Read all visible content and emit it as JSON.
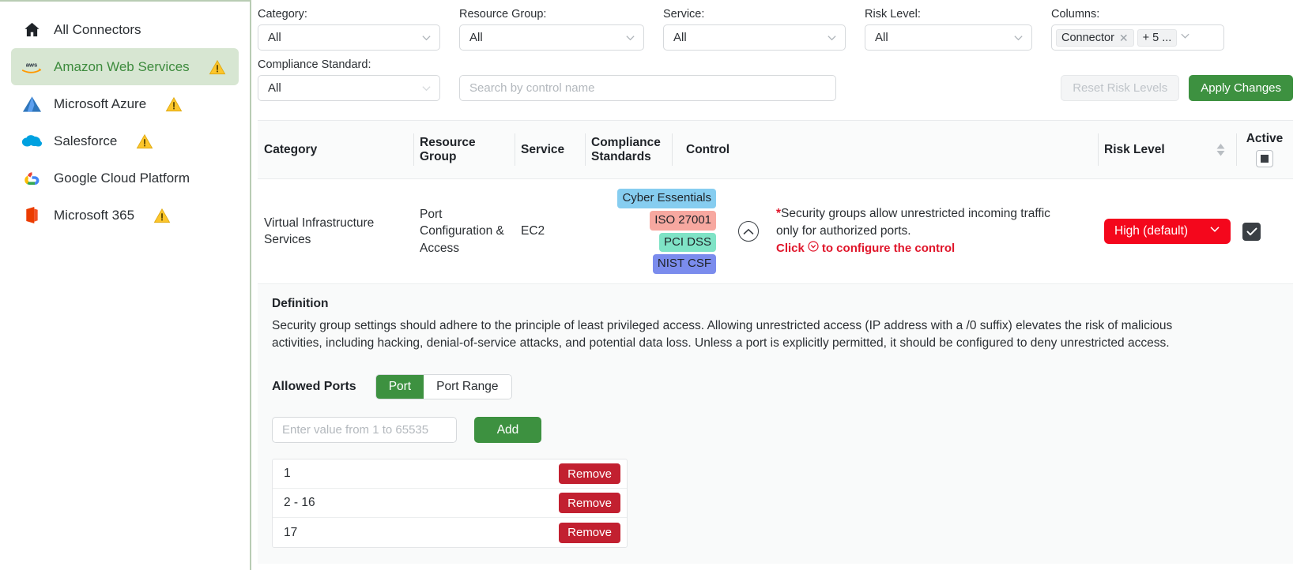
{
  "sidebar": {
    "items": [
      {
        "label": "All Connectors",
        "icon": "home-icon",
        "warning": false,
        "active": false
      },
      {
        "label": "Amazon Web Services",
        "icon": "aws-icon",
        "warning": true,
        "active": true
      },
      {
        "label": "Microsoft Azure",
        "icon": "azure-icon",
        "warning": true,
        "active": false
      },
      {
        "label": "Salesforce",
        "icon": "salesforce-icon",
        "warning": true,
        "active": false
      },
      {
        "label": "Google Cloud Platform",
        "icon": "gcp-icon",
        "warning": false,
        "active": false
      },
      {
        "label": "Microsoft 365",
        "icon": "microsoft365-icon",
        "warning": true,
        "active": false
      }
    ]
  },
  "filters": {
    "category": {
      "label": "Category:",
      "value": "All"
    },
    "resource_group": {
      "label": "Resource Group:",
      "value": "All"
    },
    "service": {
      "label": "Service:",
      "value": "All"
    },
    "risk_level": {
      "label": "Risk Level:",
      "value": "All"
    },
    "columns": {
      "label": "Columns:",
      "chip": "Connector",
      "more": "+ 5 ..."
    },
    "compliance_standard": {
      "label": "Compliance Standard:",
      "value": "All"
    },
    "search_placeholder": "Search by control name",
    "search_value": "",
    "reset_button": "Reset Risk Levels",
    "apply_button": "Apply Changes"
  },
  "table": {
    "headers": {
      "category": "Category",
      "resource_group": "Resource Group",
      "service": "Service",
      "compliance_standards": "Compliance Standards",
      "control": "Control",
      "risk_level": "Risk Level",
      "active": "Active"
    },
    "rows": [
      {
        "category": "Virtual Infrastructure Services",
        "resource_group": "Port Configuration & Access",
        "service": "EC2",
        "badges": [
          {
            "label": "Cyber Essentials",
            "color": "#86cdf0"
          },
          {
            "label": "ISO 27001",
            "color": "#f7a8a0"
          },
          {
            "label": "PCI DSS",
            "color": "#7fe3c6"
          },
          {
            "label": "NIST CSF",
            "color": "#7b8ced"
          }
        ],
        "control_text": "Security groups allow unrestricted incoming traffic only for authorized ports.",
        "control_required_marker": "*",
        "config_hint_prefix": "Click",
        "config_hint_suffix": "to configure the control",
        "risk_level": "High (default)",
        "active": true
      }
    ]
  },
  "detail": {
    "definition_title": "Definition",
    "definition_text": "Security group settings should adhere to the principle of least privileged access. Allowing unrestricted access (IP address with a /0 suffix) elevates the risk of malicious activities, including hacking, denial-of-service attacks, and potential data loss. Unless a port is explicitly permitted, it should be configured to deny unrestricted access.",
    "allowed_ports_label": "Allowed Ports",
    "toggle_port": "Port",
    "toggle_port_range": "Port Range",
    "port_input_placeholder": "Enter value from 1 to 65535",
    "port_input_value": "",
    "add_button": "Add",
    "remove_button": "Remove",
    "ports": [
      "1",
      "2 - 16",
      "17"
    ]
  },
  "colors": {
    "accent_green": "#3d9140",
    "risk_red": "#f4071c",
    "remove_red": "#c22030",
    "active_nav_bg": "#d7e6d2"
  }
}
